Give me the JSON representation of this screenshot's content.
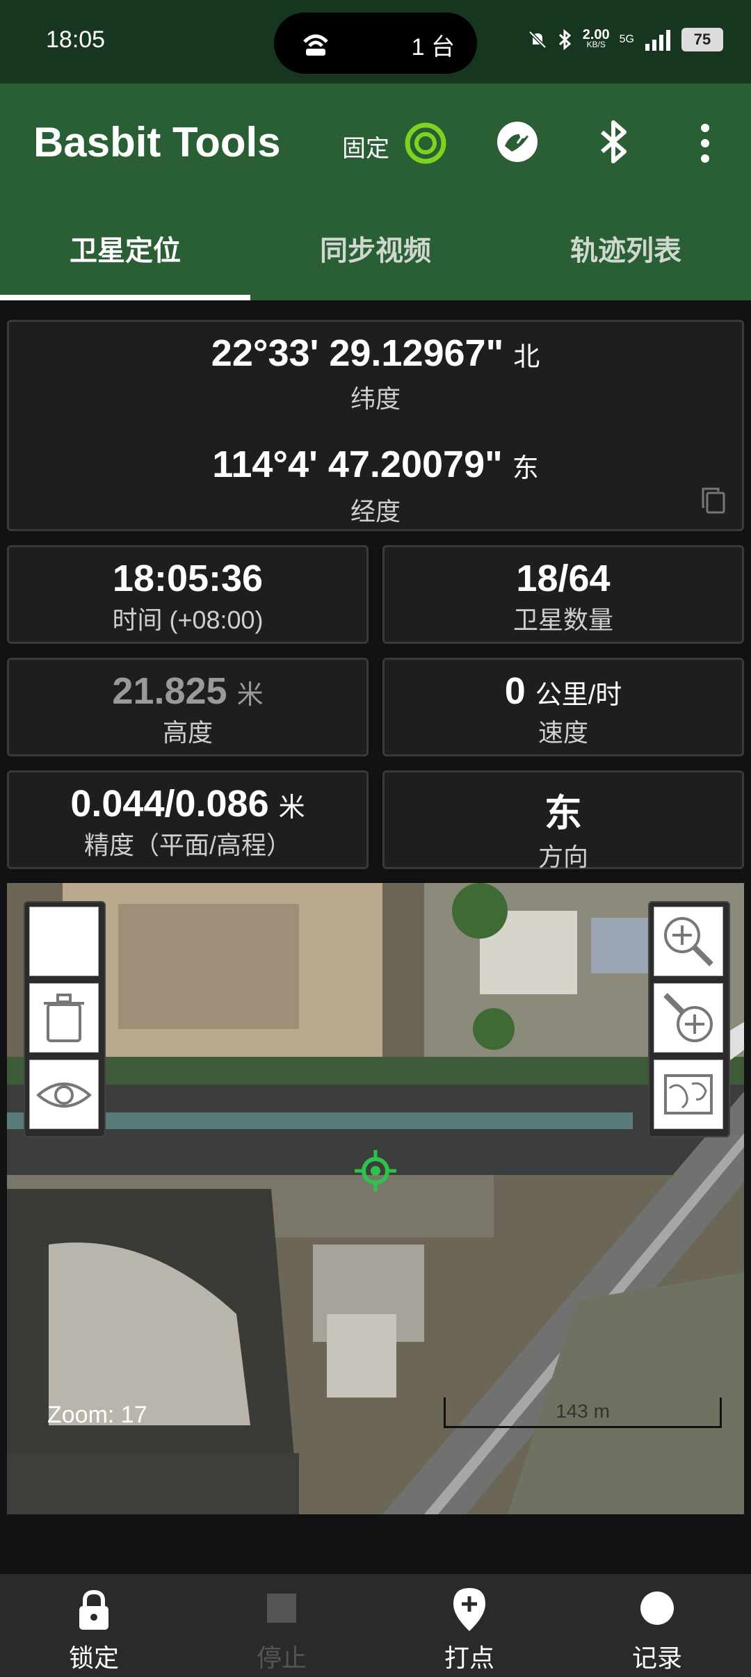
{
  "status_bar": {
    "time": "18:05",
    "devices": "1 台",
    "net_speed": "2.00",
    "net_unit": "KB/S",
    "network": "5G",
    "battery": "75"
  },
  "app_bar": {
    "title": "Basbit Tools",
    "fixed_label": "固定"
  },
  "tabs": [
    {
      "label": "卫星定位",
      "active": true
    },
    {
      "label": "同步视频",
      "active": false
    },
    {
      "label": "轨迹列表",
      "active": false
    }
  ],
  "coords": {
    "latitude": "22°33' 29.12967\"",
    "lat_dir": "北",
    "lat_label": "纬度",
    "longitude": "114°4' 47.20079\"",
    "lon_dir": "东",
    "lon_label": "经度"
  },
  "stats": {
    "time_value": "18:05:36",
    "time_label": "时间 (+08:00)",
    "satellites_value": "18/64",
    "satellites_label": "卫星数量",
    "altitude_value": "21.825",
    "altitude_unit": "米",
    "altitude_label": "高度",
    "speed_value": "0",
    "speed_unit": "公里/时",
    "speed_label": "速度",
    "accuracy_value": "0.044/0.086",
    "accuracy_unit": "米",
    "accuracy_label": "精度（平面/高程）",
    "direction_value": "东",
    "direction_label": "方向"
  },
  "map": {
    "zoom_text": "Zoom: 17",
    "scale_text": "143 m",
    "left_controls": [
      "blank",
      "trash-icon",
      "eye-icon"
    ],
    "right_controls": [
      "zoom-in-icon",
      "zoom-out-icon",
      "map-layer-icon"
    ]
  },
  "bottom_nav": [
    {
      "label": "锁定",
      "icon": "lock-icon",
      "enabled": true
    },
    {
      "label": "停止",
      "icon": "stop-icon",
      "enabled": false
    },
    {
      "label": "打点",
      "icon": "add-pin-icon",
      "enabled": true
    },
    {
      "label": "记录",
      "icon": "record-icon",
      "enabled": true
    }
  ],
  "colors": {
    "status_bg": "#17361f",
    "app_bar_bg": "#2a5e35",
    "accent_green": "#7ed321",
    "card_bg": "#1e1e1e",
    "bottom_bg": "#2a2a2a"
  }
}
